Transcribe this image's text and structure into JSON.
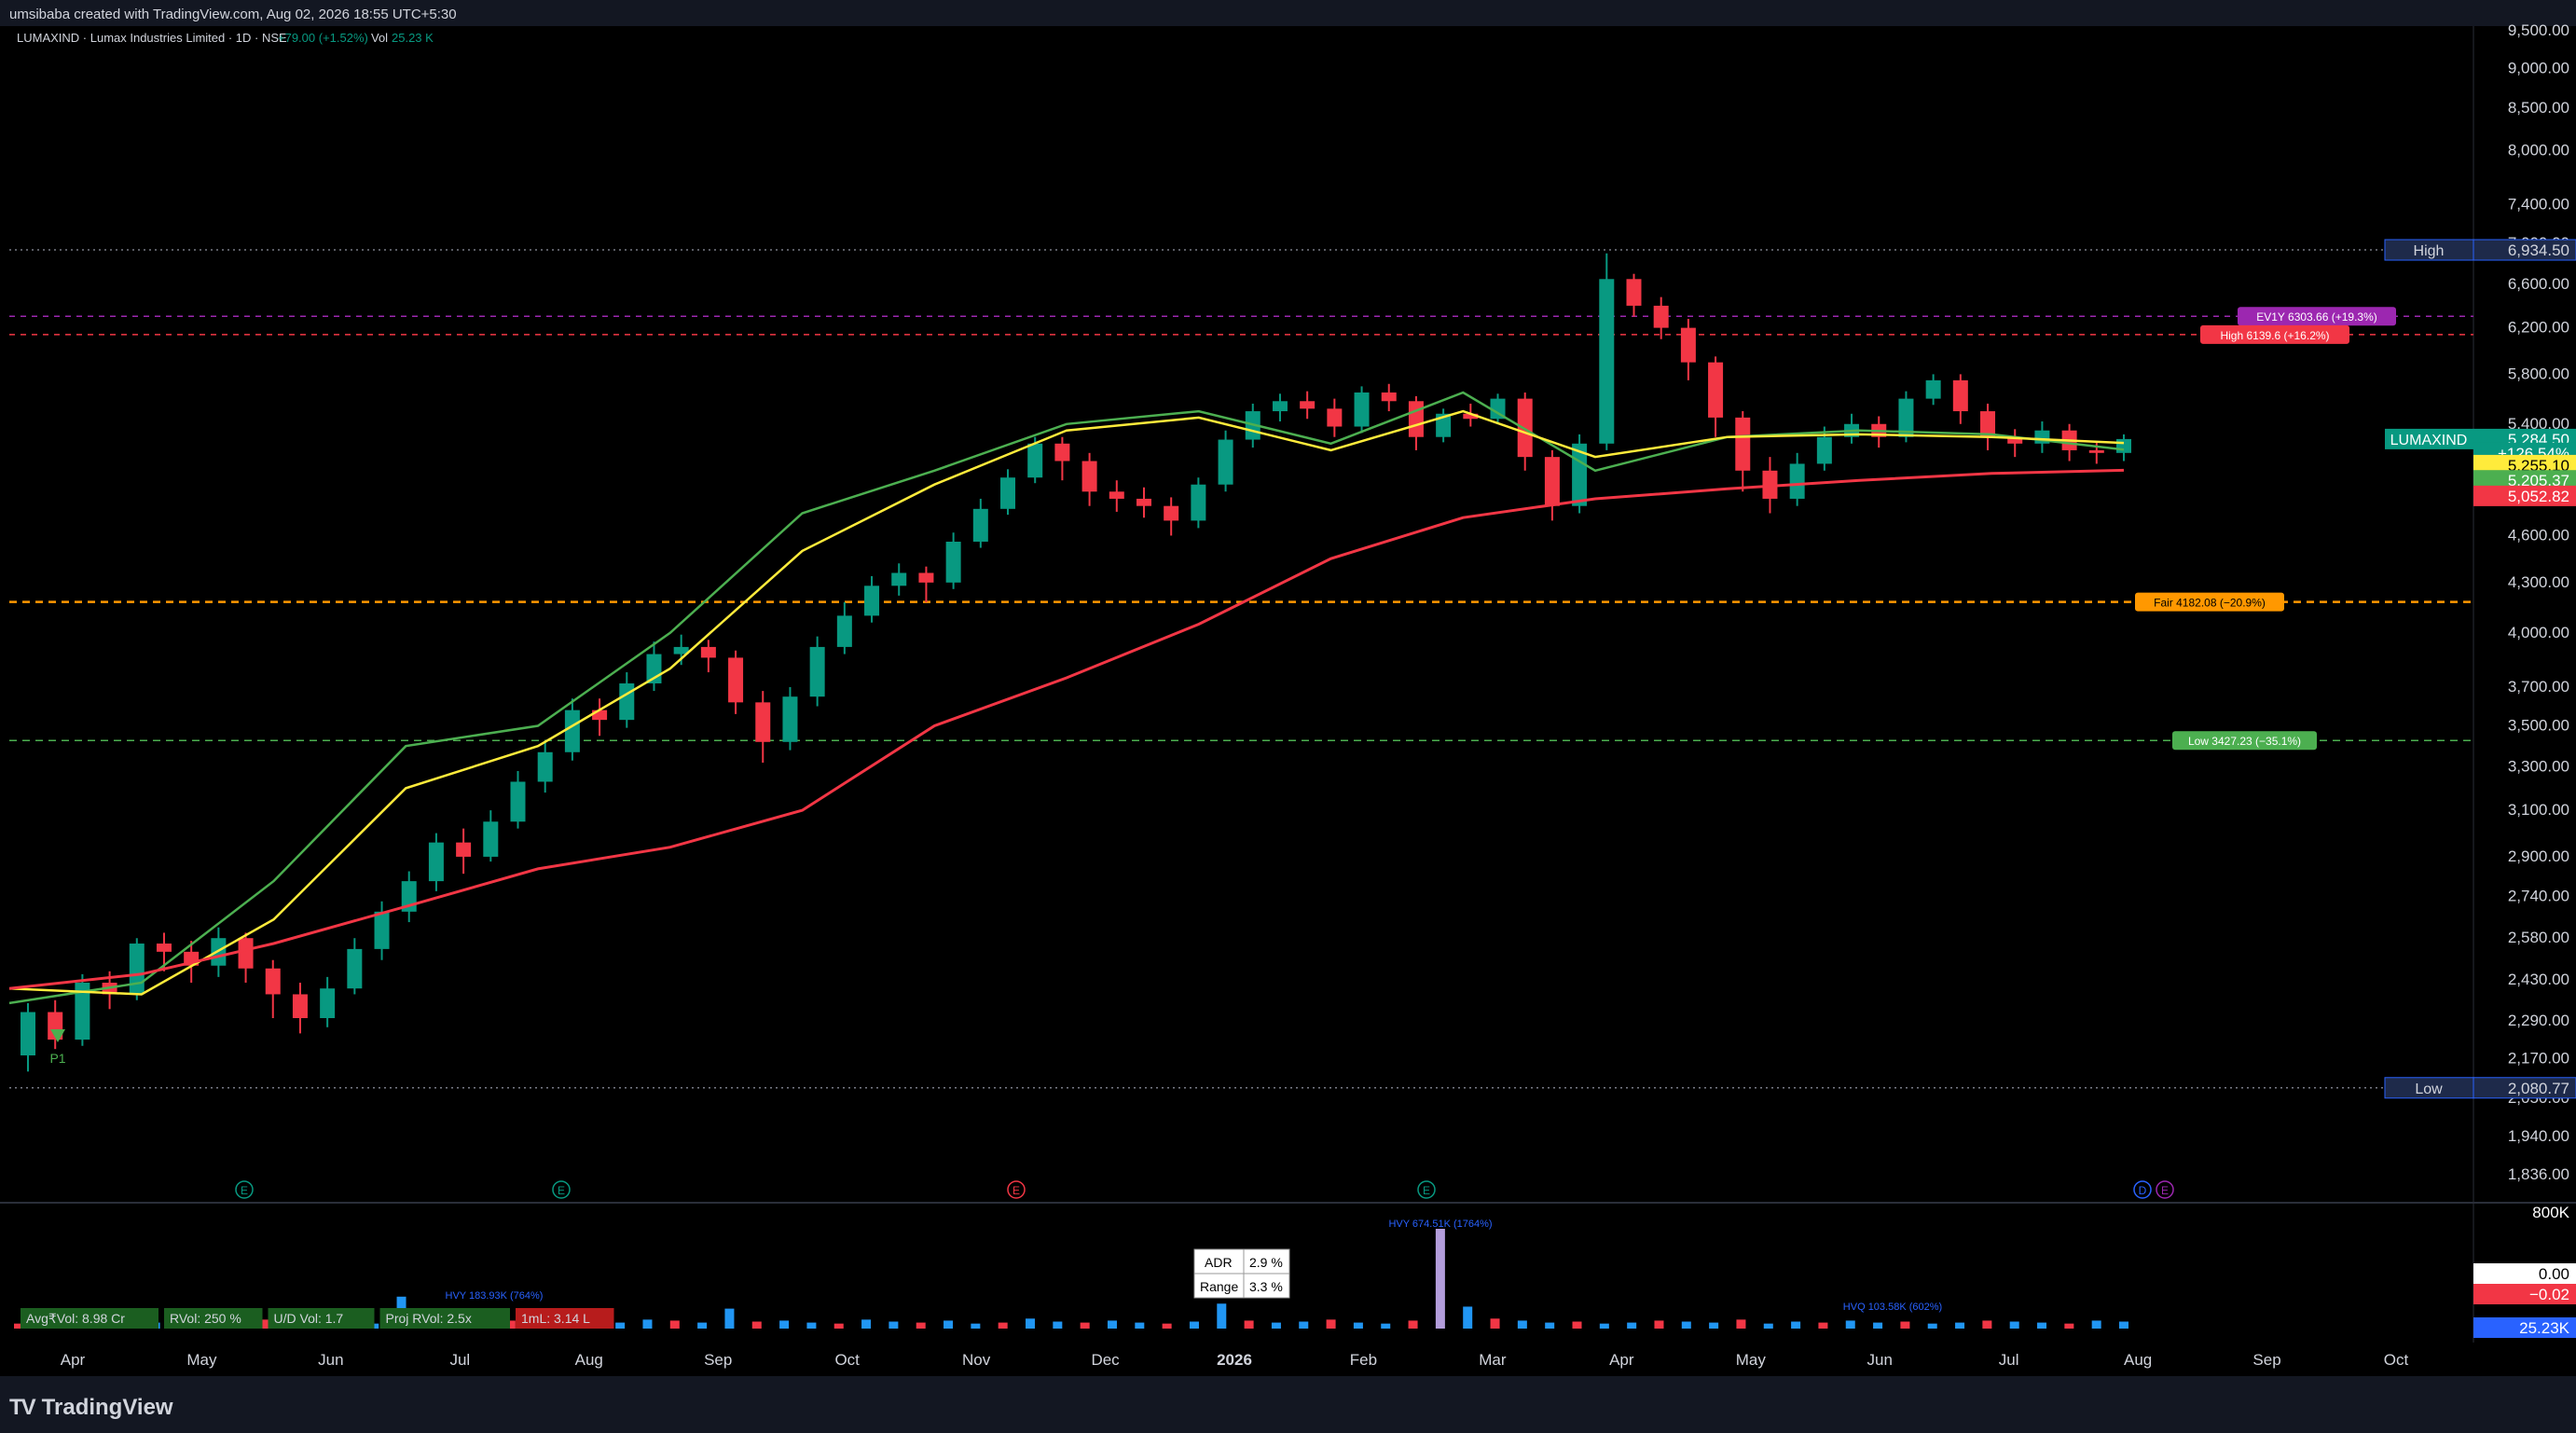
{
  "header": {
    "credit": "umsibaba created with TradingView.com, Aug 02, 2026 18:55 UTC+5:30",
    "symbol_line": "LUMAXIND · Lumax Industries Limited · 1D · NSE",
    "change": "+79.00 (+1.52%)",
    "vol_label": "Vol",
    "vol_value": "25.23 K"
  },
  "footer": {
    "brand": "TradingView",
    "logo": "TV"
  },
  "colors": {
    "background": "#000000",
    "up": "#089981",
    "down": "#f23645",
    "ema_fast": "#4caf50",
    "ema_mid": "#ffeb3b",
    "ema_slow": "#f23645",
    "fair": "#ff9800",
    "purple": "#9c27b0"
  },
  "chart_data": [
    {
      "type": "line",
      "title": "LUMAXIND · Lumax Industries Limited · 1D · NSE",
      "y_scale": "log",
      "ylim": [
        1800,
        9500
      ],
      "y_ticks": [
        "9,500.00",
        "9,000.00",
        "8,500.00",
        "8,000.00",
        "7,400.00",
        "7,000.00",
        "6,600.00",
        "6,200.00",
        "5,800.00",
        "5,400.00",
        "5,000.00",
        "4,600.00",
        "4,300.00",
        "4,000.00",
        "3,700.00",
        "3,500.00",
        "3,300.00",
        "3,100.00",
        "2,900.00",
        "2,740.00",
        "2,580.00",
        "2,430.00",
        "2,290.00",
        "2,170.00",
        "2,050.00",
        "1,940.00",
        "1,836.00"
      ],
      "x_ticks": [
        "Apr",
        "May",
        "Jun",
        "Jul",
        "Aug",
        "Sep",
        "Oct",
        "Nov",
        "Dec",
        "2026",
        "Feb",
        "Mar",
        "Apr",
        "May",
        "Jun",
        "Jul",
        "Aug",
        "Sep",
        "Oct"
      ],
      "x": [
        "Apr",
        "May",
        "Jun",
        "Jul",
        "Aug",
        "Sep",
        "Oct",
        "Nov",
        "Dec",
        "2026",
        "Feb",
        "Mar",
        "Apr",
        "May",
        "Jun",
        "Jul",
        "Aug"
      ],
      "series": [
        {
          "values": [
            2200,
            2500,
            2950,
            3700,
            3600,
            4150,
            5100,
            5150,
            5650,
            5600,
            5250,
            5800,
            4950,
            5300,
            5550,
            5300,
            5284.5
          ]
        },
        {
          "values": [
            2350,
            2420,
            2800,
            3400,
            3500,
            4000,
            4750,
            5050,
            5400,
            5500,
            5250,
            5650,
            5050,
            5300,
            5350,
            5320,
            5205.37
          ]
        },
        {
          "values": [
            2400,
            2380,
            2650,
            3200,
            3400,
            3800,
            4500,
            4950,
            5350,
            5450,
            5200,
            5500,
            5150,
            5300,
            5320,
            5300,
            5255.1
          ]
        },
        {
          "values": [
            2400,
            2450,
            2560,
            2700,
            2850,
            2940,
            3100,
            3500,
            3750,
            4050,
            4450,
            4720,
            4850,
            4920,
            4980,
            5030,
            5052.82
          ]
        }
      ],
      "candles": [
        [
          2180,
          2320,
          2130,
          2350
        ],
        [
          2320,
          2230,
          2200,
          2360
        ],
        [
          2230,
          2420,
          2210,
          2450
        ],
        [
          2420,
          2380,
          2330,
          2460
        ],
        [
          2380,
          2560,
          2360,
          2580
        ],
        [
          2560,
          2530,
          2460,
          2600
        ],
        [
          2530,
          2480,
          2420,
          2570
        ],
        [
          2480,
          2580,
          2440,
          2620
        ],
        [
          2580,
          2470,
          2420,
          2600
        ],
        [
          2470,
          2380,
          2300,
          2500
        ],
        [
          2380,
          2300,
          2250,
          2420
        ],
        [
          2300,
          2400,
          2270,
          2440
        ],
        [
          2400,
          2540,
          2380,
          2580
        ],
        [
          2540,
          2680,
          2500,
          2720
        ],
        [
          2680,
          2800,
          2640,
          2840
        ],
        [
          2800,
          2960,
          2760,
          3000
        ],
        [
          2960,
          2900,
          2830,
          3020
        ],
        [
          2900,
          3050,
          2880,
          3100
        ],
        [
          3050,
          3230,
          3020,
          3280
        ],
        [
          3230,
          3370,
          3180,
          3420
        ],
        [
          3370,
          3580,
          3330,
          3640
        ],
        [
          3580,
          3530,
          3450,
          3640
        ],
        [
          3530,
          3720,
          3490,
          3780
        ],
        [
          3720,
          3880,
          3680,
          3950
        ],
        [
          3880,
          3920,
          3820,
          3990
        ],
        [
          3920,
          3860,
          3780,
          3960
        ],
        [
          3860,
          3620,
          3560,
          3900
        ],
        [
          3620,
          3420,
          3320,
          3680
        ],
        [
          3420,
          3650,
          3380,
          3700
        ],
        [
          3650,
          3920,
          3600,
          3980
        ],
        [
          3920,
          4100,
          3880,
          4180
        ],
        [
          4100,
          4280,
          4060,
          4340
        ],
        [
          4280,
          4360,
          4220,
          4420
        ],
        [
          4360,
          4300,
          4180,
          4400
        ],
        [
          4300,
          4560,
          4260,
          4620
        ],
        [
          4560,
          4780,
          4520,
          4850
        ],
        [
          4780,
          5000,
          4740,
          5060
        ],
        [
          5000,
          5250,
          4960,
          5300
        ],
        [
          5250,
          5120,
          4980,
          5300
        ],
        [
          5120,
          4900,
          4800,
          5180
        ],
        [
          4900,
          4850,
          4760,
          4980
        ],
        [
          4850,
          4800,
          4720,
          4930
        ],
        [
          4800,
          4700,
          4600,
          4860
        ],
        [
          4700,
          4950,
          4650,
          5000
        ],
        [
          4950,
          5280,
          4900,
          5350
        ],
        [
          5280,
          5500,
          5220,
          5560
        ],
        [
          5500,
          5580,
          5420,
          5640
        ],
        [
          5580,
          5520,
          5440,
          5660
        ],
        [
          5520,
          5380,
          5300,
          5600
        ],
        [
          5380,
          5650,
          5330,
          5700
        ],
        [
          5650,
          5580,
          5500,
          5720
        ],
        [
          5580,
          5300,
          5200,
          5620
        ],
        [
          5300,
          5480,
          5260,
          5520
        ],
        [
          5480,
          5440,
          5380,
          5560
        ],
        [
          5440,
          5600,
          5400,
          5640
        ],
        [
          5600,
          5150,
          5050,
          5650
        ],
        [
          5150,
          4800,
          4700,
          5200
        ],
        [
          4800,
          5250,
          4750,
          5320
        ],
        [
          5250,
          6650,
          5200,
          6900
        ],
        [
          6650,
          6400,
          6300,
          6700
        ],
        [
          6400,
          6200,
          6100,
          6480
        ],
        [
          6200,
          5900,
          5750,
          6280
        ],
        [
          5900,
          5450,
          5300,
          5950
        ],
        [
          5450,
          5050,
          4900,
          5500
        ],
        [
          5050,
          4850,
          4750,
          5150
        ],
        [
          4850,
          5100,
          4800,
          5180
        ],
        [
          5100,
          5300,
          5050,
          5380
        ],
        [
          5300,
          5400,
          5250,
          5480
        ],
        [
          5400,
          5300,
          5220,
          5460
        ],
        [
          5300,
          5600,
          5260,
          5660
        ],
        [
          5600,
          5750,
          5550,
          5800
        ],
        [
          5750,
          5500,
          5400,
          5800
        ],
        [
          5500,
          5300,
          5200,
          5560
        ],
        [
          5300,
          5250,
          5150,
          5360
        ],
        [
          5250,
          5350,
          5180,
          5420
        ],
        [
          5350,
          5200,
          5120,
          5400
        ],
        [
          5200,
          5180,
          5100,
          5260
        ],
        [
          5180,
          5284.5,
          5120,
          5320
        ]
      ],
      "levels": [
        {
          "label": "High",
          "value": "6,934.50",
          "price": 6934.5
        },
        {
          "label": "Low",
          "value": "2,080.77",
          "price": 2080.77
        },
        {
          "label": "EV1Y 6303.66 (+19.3%)",
          "price": 6303.66
        },
        {
          "label": "High 6139.6 (+16.2%)",
          "price": 6139.6
        },
        {
          "label": "Fair 4182.08 (−20.9%)",
          "price": 4182.08
        },
        {
          "label": "Low 3427.23 (−35.1%)",
          "price": 3427.23
        }
      ],
      "price_labels": [
        {
          "label": "LUMAXIND",
          "value": "5,284.50",
          "price": 5284.5,
          "color": "#089981"
        },
        {
          "label": "",
          "value": "+126.54%",
          "price": 5180,
          "color": "#089981"
        },
        {
          "label": "",
          "value": "5,255.10",
          "price": 5090,
          "color": "#ffeb3b"
        },
        {
          "label": "",
          "value": "5,205.37",
          "price": 4980,
          "color": "#4caf50"
        },
        {
          "label": "",
          "value": "5,052.82",
          "price": 4870,
          "color": "#f23645"
        }
      ],
      "annotations": [
        "P1"
      ],
      "event_markers": [
        "E",
        "E",
        "E",
        "E",
        "D",
        "E"
      ]
    },
    {
      "type": "line",
      "title": "",
      "y_ticks": [
        "800K",
        "0.00",
        "−0.02",
        "25.23K"
      ],
      "stats": [
        {
          "label": "Avg₹Vol",
          "value": "8.98 Cr"
        },
        {
          "label": "RVol",
          "value": "250 %"
        },
        {
          "label": "U/D Vol",
          "value": "1.7"
        },
        {
          "label": "Proj RVol",
          "value": "2.5x"
        },
        {
          "label": "1mL",
          "value": "3.14 L"
        }
      ],
      "adr": {
        "label": "ADR",
        "value": "2.9 %"
      },
      "range": {
        "label": "Range",
        "value": "3.3 %"
      },
      "hvy_labels": [
        "HVY 183.93K (764%)",
        "HVY 674.51K (1764%)",
        "HVQ 103.58K (602%)"
      ],
      "volume": [
        0.05,
        0.04,
        0.06,
        0.05,
        0.08,
        0.06,
        0.05,
        0.1,
        0.07,
        0.09,
        0.05,
        0.06,
        0.08,
        0.05,
        0.32,
        0.07,
        0.06,
        0.12,
        0.08,
        0.1,
        0.05,
        0.07,
        0.06,
        0.09,
        0.08,
        0.06,
        0.2,
        0.07,
        0.08,
        0.06,
        0.05,
        0.09,
        0.07,
        0.06,
        0.08,
        0.05,
        0.06,
        0.1,
        0.07,
        0.06,
        0.08,
        0.06,
        0.05,
        0.07,
        0.25,
        0.08,
        0.06,
        0.07,
        0.09,
        0.06,
        0.05,
        0.08,
        1.0,
        0.22,
        0.1,
        0.08,
        0.06,
        0.07,
        0.05,
        0.06,
        0.08,
        0.07,
        0.06,
        0.09,
        0.05,
        0.07,
        0.06,
        0.08,
        0.06,
        0.07,
        0.05,
        0.06,
        0.08,
        0.07,
        0.06,
        0.05,
        0.08,
        0.07
      ]
    }
  ]
}
